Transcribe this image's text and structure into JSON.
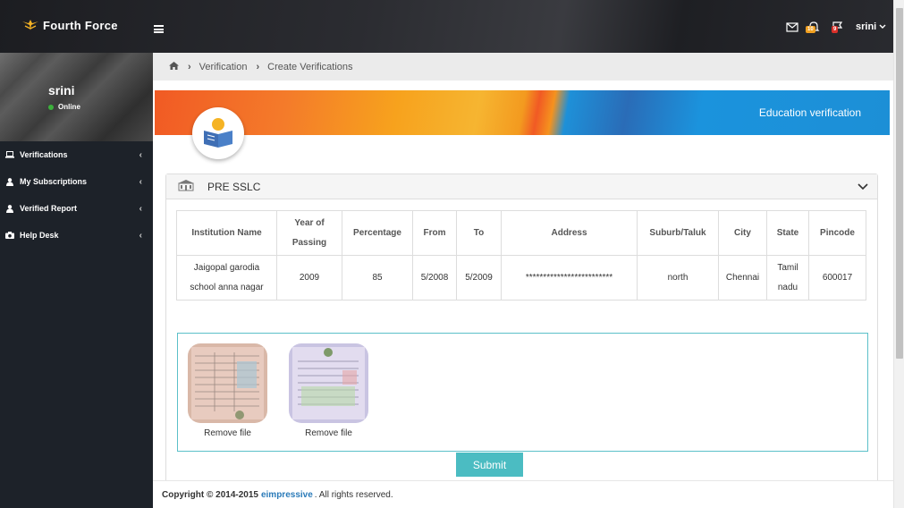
{
  "app": {
    "name": "Fourth Force"
  },
  "header": {
    "user": "srini",
    "mail_badge": "",
    "bell_badge": "10",
    "flag_badge": "9"
  },
  "sidebar": {
    "profile_name": "srini",
    "profile_status": "Online",
    "items": [
      {
        "label": "Verifications",
        "icon": "laptop-icon"
      },
      {
        "label": "My Subscriptions",
        "icon": "user-icon"
      },
      {
        "label": "Verified Report",
        "icon": "user-icon"
      },
      {
        "label": "Help Desk",
        "icon": "camera-icon"
      }
    ]
  },
  "breadcrumb": {
    "level1": "Verification",
    "level2": "Create Verifications"
  },
  "hero": {
    "title": "Education verification"
  },
  "panel": {
    "title": "PRE SSLC",
    "columns": [
      "Institution Name",
      "Year of Passing",
      "Percentage",
      "From",
      "To",
      "Address",
      "Suburb/Taluk",
      "City",
      "State",
      "Pincode"
    ],
    "row": [
      "Jaigopal garodia school anna nagar",
      "2009",
      "85",
      "5/2008",
      "5/2009",
      "*************************",
      "north",
      "Chennai",
      "Tamil nadu",
      "600017"
    ]
  },
  "files": [
    {
      "remove_label": "Remove file"
    },
    {
      "remove_label": "Remove file"
    }
  ],
  "submit_label": "Submit",
  "footer": {
    "copyright": "Copyright © 2014-2015",
    "brand": "eimpressive",
    "suffix": ". All rights reserved."
  },
  "colors": {
    "accent": "#4bbcc2",
    "sidebar": "#1d2229",
    "brand_link": "#2b7bb9"
  }
}
